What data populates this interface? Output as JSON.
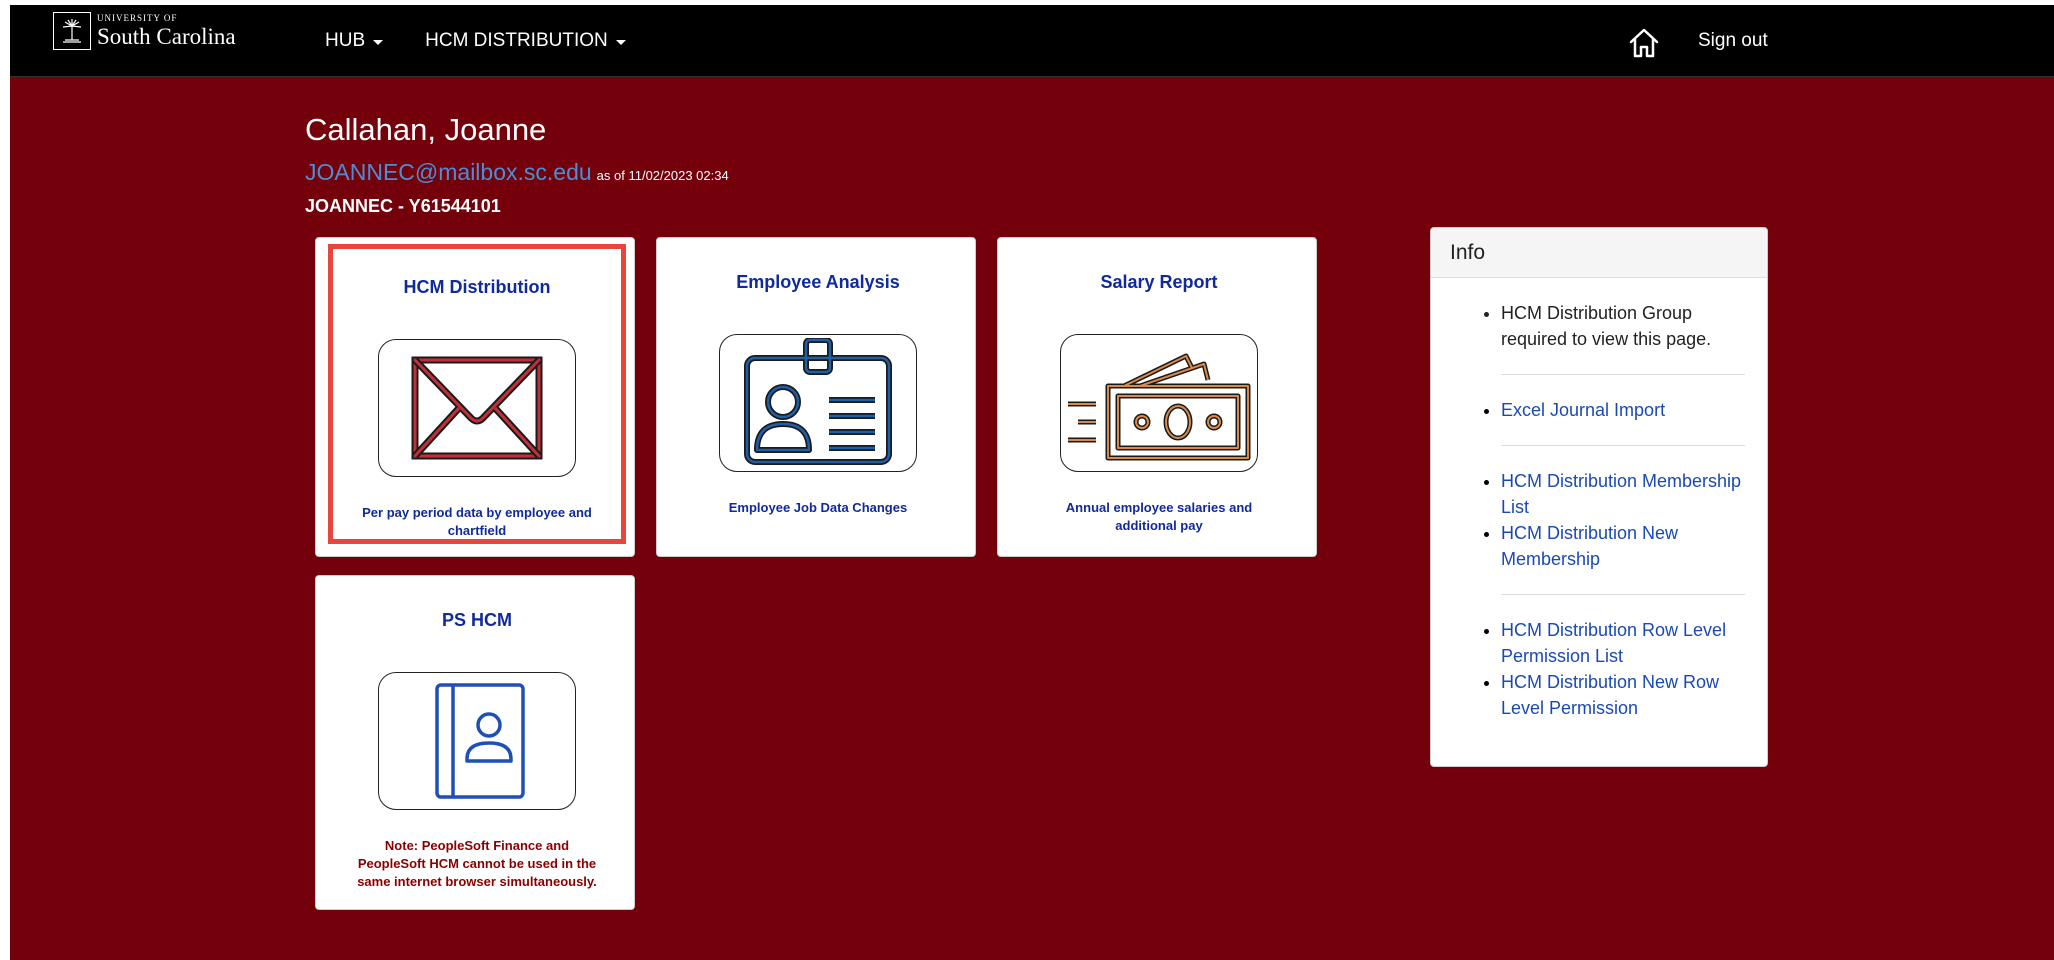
{
  "navbar": {
    "logo": {
      "small_text": "University of",
      "big_text": "South Carolina",
      "icon": "palmetto-tree-icon"
    },
    "menus": [
      {
        "label": "HUB"
      },
      {
        "label": "HCM DISTRIBUTION"
      }
    ],
    "home_icon": "home-icon",
    "sign_out": "Sign out"
  },
  "user": {
    "name": "Callahan, Joanne",
    "email": "JOANNEC@mailbox.sc.edu",
    "as_of": "as of 11/02/2023 02:34",
    "id_line": "JOANNEC - Y61544101"
  },
  "cards": [
    {
      "title": "HCM Distribution",
      "icon": "envelope-icon",
      "description": "Per pay period data by employee and chartfield",
      "selected": true
    },
    {
      "title": "Employee Analysis",
      "icon": "id-badge-icon",
      "description": "Employee Job Data Changes"
    },
    {
      "title": "Salary Report",
      "icon": "money-bills-icon",
      "description": "Annual employee salaries and additional pay"
    },
    {
      "title": "PS HCM",
      "icon": "contact-book-icon",
      "description": "Note: PeopleSoft Finance and PeopleSoft HCM cannot be used in the same internet browser simultaneously."
    }
  ],
  "info": {
    "title": "Info",
    "requirement": "HCM Distribution Group required to view this page.",
    "links": {
      "excel_import": "Excel Journal Import",
      "membership_list": "HCM Distribution Membership List",
      "new_membership": "HCM Distribution New Membership",
      "row_level_list": "HCM Distribution Row Level Permission List",
      "new_row_level": "HCM Distribution New Row Level Permission"
    }
  },
  "colors": {
    "background": "#73000a",
    "navbar": "#000000",
    "card_title": "#102a9e",
    "selected_border": "#e8463c",
    "link": "#1a49b6",
    "note": "#8a0000"
  }
}
